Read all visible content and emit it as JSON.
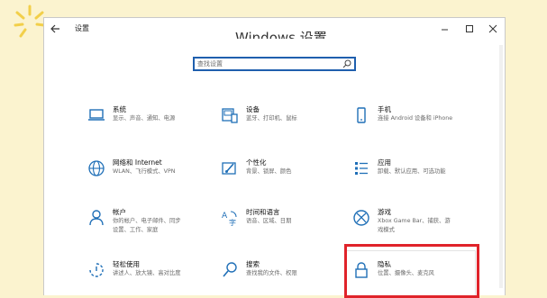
{
  "window": {
    "app_title": "设置",
    "page_title": "Windows 设置",
    "controls": [
      "minimize",
      "maximize",
      "close"
    ]
  },
  "search": {
    "placeholder": "查找设置",
    "icon": "search-icon"
  },
  "categories": [
    {
      "name": "系统",
      "desc": "显示、声音、通知、电源",
      "icon": "laptop-icon"
    },
    {
      "name": "设备",
      "desc": "蓝牙、打印机、鼠标",
      "icon": "devices-icon"
    },
    {
      "name": "手机",
      "desc": "连接 Android 设备和 iPhone",
      "icon": "phone-icon"
    },
    {
      "name": "网络和 Internet",
      "desc": "WLAN、飞行模式、VPN",
      "icon": "globe-icon"
    },
    {
      "name": "个性化",
      "desc": "背景、锁屏、颜色",
      "icon": "paintbrush-icon"
    },
    {
      "name": "应用",
      "desc": "卸载、默认应用、可选功能",
      "icon": "apps-icon"
    },
    {
      "name": "帐户",
      "desc": "你的帐户、电子邮件、同步设置、工作、家庭",
      "icon": "person-icon"
    },
    {
      "name": "时间和语言",
      "desc": "语音、区域、日期",
      "icon": "time-language-icon"
    },
    {
      "name": "游戏",
      "desc": "Xbox Game Bar、捕获、游戏模式",
      "icon": "xbox-icon"
    },
    {
      "name": "轻松使用",
      "desc": "讲述人、放大镜、高对比度",
      "icon": "ease-of-access-icon"
    },
    {
      "name": "搜索",
      "desc": "查找我的文件、权限",
      "icon": "search-icon"
    },
    {
      "name": "隐私",
      "desc": "位置、摄像头、麦克风",
      "icon": "lock-icon"
    }
  ],
  "colors": {
    "accent": "#1f6fb7",
    "highlight": "#e0232a",
    "background": "#fbf3cf"
  }
}
